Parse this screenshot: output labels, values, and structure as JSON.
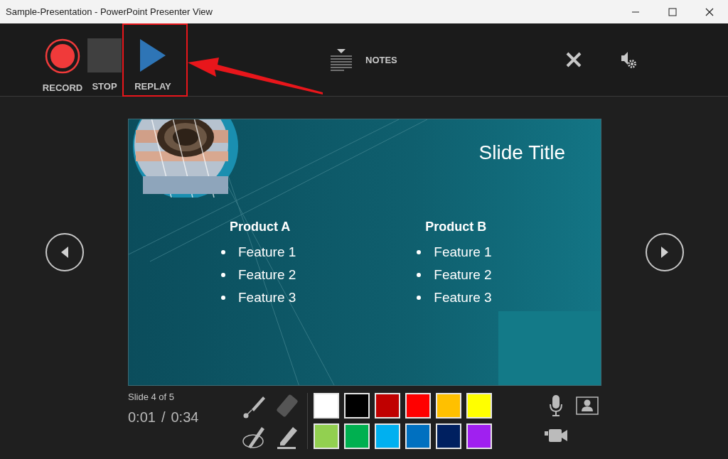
{
  "window": {
    "title": "Sample-Presentation - PowerPoint Presenter View"
  },
  "toolbar": {
    "buttons": [
      {
        "kind": "record",
        "label": "RECORD"
      },
      {
        "kind": "stop",
        "label": "STOP"
      },
      {
        "kind": "replay",
        "label": "REPLAY"
      }
    ],
    "notes": {
      "label": "NOTES"
    }
  },
  "slide": {
    "title": "Slide Title",
    "columns": [
      {
        "heading": "Product A",
        "bullets": [
          "Feature 1",
          "Feature 2",
          "Feature 3"
        ]
      },
      {
        "heading": "Product B",
        "bullets": [
          "Feature 1",
          "Feature 2",
          "Feature 3"
        ]
      }
    ]
  },
  "status": {
    "slide_counter": "Slide 4 of 5",
    "elapsed": "0:01",
    "separator": "/",
    "duration": "0:34"
  },
  "palette": [
    {
      "color": "#ffffff"
    },
    {
      "color": "#000000"
    },
    {
      "color": "#c00000"
    },
    {
      "color": "#ff0000"
    },
    {
      "color": "#ffc000"
    },
    {
      "color": "#ffff00"
    },
    {
      "color": "#92d050"
    },
    {
      "color": "#00b050"
    },
    {
      "color": "#00b0f0"
    },
    {
      "color": "#0070c0"
    },
    {
      "color": "#002060"
    },
    {
      "color": "#a020f0"
    }
  ]
}
